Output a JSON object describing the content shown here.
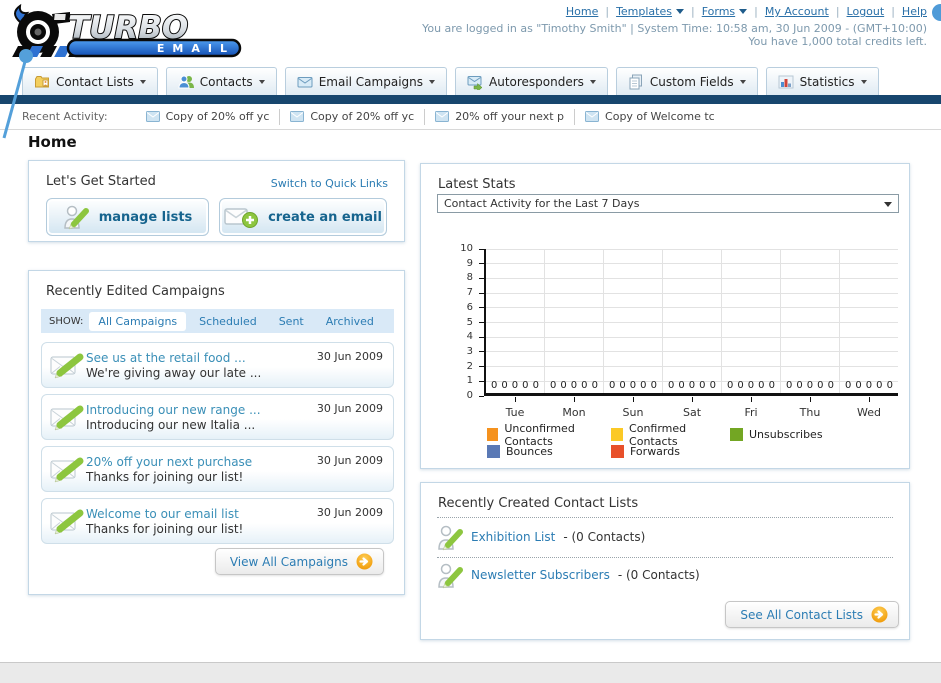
{
  "theme": {
    "navy": "#17466e",
    "link": "#2b7cb3",
    "link-dark": "#16648e",
    "orange": "#f09800",
    "panel-border": "#c3d7e6",
    "filter-bar-bg": "#d9e9f7"
  },
  "header": {
    "logo_title": "TURBO",
    "logo_subtitle": "EMAIL",
    "separator": "|",
    "links": [
      {
        "label": "Home",
        "dropdown": false
      },
      {
        "label": "Templates",
        "dropdown": true
      },
      {
        "label": "Forms",
        "dropdown": true
      },
      {
        "label": "My Account",
        "dropdown": false
      },
      {
        "label": "Logout",
        "dropdown": false
      },
      {
        "label": "Help",
        "dropdown": false
      }
    ],
    "login_info": "You are logged in as \"Timothy Smith\" | System Time: 10:58 am, 30 Jun 2009 - (GMT+10:00)",
    "credits_info": "You have 1,000 total credits left."
  },
  "nav_tabs": [
    {
      "label": "Contact Lists",
      "icon": "contact-lists-folder-icon"
    },
    {
      "label": "Contacts",
      "icon": "contacts-people-icon"
    },
    {
      "label": "Email Campaigns",
      "icon": "email-envelope-icon"
    },
    {
      "label": "Autoresponders",
      "icon": "autoresponder-envelope-icon"
    },
    {
      "label": "Custom Fields",
      "icon": "custom-fields-pages-icon"
    },
    {
      "label": "Statistics",
      "icon": "statistics-bars-icon"
    }
  ],
  "recent_activity": {
    "label": "Recent Activity:",
    "items": [
      "Copy of 20% off yc",
      "Copy of 20% off yc",
      "20% off your next p",
      "Copy of Welcome tc"
    ]
  },
  "page": {
    "title": "Home"
  },
  "get_started": {
    "title": "Let's Get Started",
    "switch_link": "Switch to Quick Links",
    "manage_lists_label": "manage lists",
    "create_email_label": "create an email"
  },
  "campaigns": {
    "title": "Recently Edited Campaigns",
    "filter_label": "SHOW:",
    "filters": [
      "All Campaigns",
      "Scheduled",
      "Sent",
      "Archived"
    ],
    "active_filter": "All Campaigns",
    "items": [
      {
        "title": "See us at the retail food ...",
        "subtitle": "We're giving away our late ...",
        "date": "30 Jun 2009"
      },
      {
        "title": "Introducing our new range ...",
        "subtitle": "Introducing our new Italia ...",
        "date": "30 Jun 2009"
      },
      {
        "title": "20% off your next purchase",
        "subtitle": "Thanks for joining our list!",
        "date": "30 Jun 2009"
      },
      {
        "title": "Welcome to our email list",
        "subtitle": "Thanks for joining our list!",
        "date": "30 Jun 2009"
      }
    ],
    "view_all_label": "View All Campaigns"
  },
  "stats": {
    "title": "Latest Stats",
    "dropdown_value": "Contact Activity for the Last 7 Days"
  },
  "chart_data": {
    "type": "bar",
    "title": "Contact Activity for the Last 7 Days",
    "categories": [
      "Tue",
      "Mon",
      "Sun",
      "Sat",
      "Fri",
      "Thu",
      "Wed"
    ],
    "series": [
      {
        "name": "Unconfirmed Contacts",
        "color": "#f5921e",
        "values": [
          0,
          0,
          0,
          0,
          0,
          0,
          0
        ]
      },
      {
        "name": "Confirmed Contacts",
        "color": "#fbc926",
        "values": [
          0,
          0,
          0,
          0,
          0,
          0,
          0
        ]
      },
      {
        "name": "Unsubscribes",
        "color": "#73a623",
        "values": [
          0,
          0,
          0,
          0,
          0,
          0,
          0
        ]
      },
      {
        "name": "Bounces",
        "color": "#5a79b5",
        "values": [
          0,
          0,
          0,
          0,
          0,
          0,
          0
        ]
      },
      {
        "name": "Forwards",
        "color": "#e8502a",
        "values": [
          0,
          0,
          0,
          0,
          0,
          0,
          0
        ]
      }
    ],
    "ylim": [
      0,
      10
    ],
    "yticks": [
      0,
      1,
      2,
      3,
      4,
      5,
      6,
      7,
      8,
      9,
      10
    ],
    "grid": true,
    "legend_position": "bottom",
    "value_labels_shown": true
  },
  "contact_lists": {
    "title": "Recently Created Contact Lists",
    "items": [
      {
        "name": "Exhibition List",
        "detail": "- (0 Contacts)"
      },
      {
        "name": "Newsletter Subscribers",
        "detail": "- (0 Contacts)"
      }
    ],
    "see_all_label": "See All Contact Lists"
  }
}
